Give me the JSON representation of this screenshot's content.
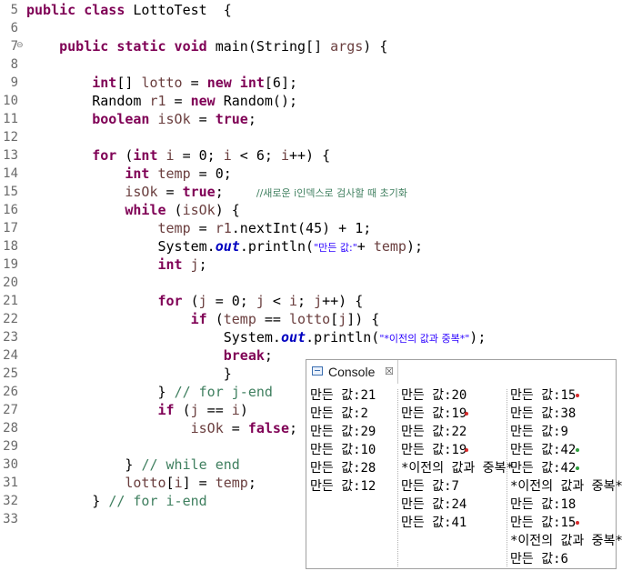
{
  "editor": {
    "lines": [
      {
        "n": "5",
        "tokens": [
          {
            "t": "public class",
            "c": "kw"
          },
          {
            "t": " LottoTest  {"
          }
        ]
      },
      {
        "n": "6",
        "tokens": []
      },
      {
        "n": "7",
        "fold": "⊖",
        "tokens": [
          {
            "t": "    "
          },
          {
            "t": "public static void",
            "c": "kw"
          },
          {
            "t": " main(String[] "
          },
          {
            "t": "args",
            "c": "var"
          },
          {
            "t": ") {"
          }
        ]
      },
      {
        "n": "8",
        "tokens": []
      },
      {
        "n": "9",
        "tokens": [
          {
            "t": "        "
          },
          {
            "t": "int",
            "c": "kw"
          },
          {
            "t": "[] "
          },
          {
            "t": "lotto",
            "c": "var"
          },
          {
            "t": " = "
          },
          {
            "t": "new int",
            "c": "kw"
          },
          {
            "t": "[6];"
          }
        ]
      },
      {
        "n": "10",
        "tokens": [
          {
            "t": "        Random "
          },
          {
            "t": "r1",
            "c": "var"
          },
          {
            "t": " = "
          },
          {
            "t": "new",
            "c": "kw"
          },
          {
            "t": " Random();"
          }
        ]
      },
      {
        "n": "11",
        "tokens": [
          {
            "t": "        "
          },
          {
            "t": "boolean",
            "c": "kw"
          },
          {
            "t": " "
          },
          {
            "t": "isOk",
            "c": "var"
          },
          {
            "t": " = "
          },
          {
            "t": "true",
            "c": "kw"
          },
          {
            "t": ";"
          }
        ]
      },
      {
        "n": "12",
        "tokens": []
      },
      {
        "n": "13",
        "tokens": [
          {
            "t": "        "
          },
          {
            "t": "for",
            "c": "kw"
          },
          {
            "t": " ("
          },
          {
            "t": "int",
            "c": "kw"
          },
          {
            "t": " "
          },
          {
            "t": "i",
            "c": "var"
          },
          {
            "t": " = 0; "
          },
          {
            "t": "i",
            "c": "var"
          },
          {
            "t": " < 6; "
          },
          {
            "t": "i",
            "c": "var"
          },
          {
            "t": "++) {"
          }
        ]
      },
      {
        "n": "14",
        "tokens": [
          {
            "t": "            "
          },
          {
            "t": "int",
            "c": "kw"
          },
          {
            "t": " "
          },
          {
            "t": "temp",
            "c": "var"
          },
          {
            "t": " = 0;"
          }
        ]
      },
      {
        "n": "15",
        "tokens": [
          {
            "t": "            "
          },
          {
            "t": "isOk",
            "c": "var"
          },
          {
            "t": " = "
          },
          {
            "t": "true",
            "c": "kw"
          },
          {
            "t": ";    "
          },
          {
            "t": "//새로운 i인덱스로 검사할 때 초기화",
            "c": "cm kor"
          }
        ]
      },
      {
        "n": "16",
        "tokens": [
          {
            "t": "            "
          },
          {
            "t": "while",
            "c": "kw"
          },
          {
            "t": " ("
          },
          {
            "t": "isOk",
            "c": "var"
          },
          {
            "t": ") {"
          }
        ]
      },
      {
        "n": "17",
        "tokens": [
          {
            "t": "                "
          },
          {
            "t": "temp",
            "c": "var"
          },
          {
            "t": " = "
          },
          {
            "t": "r1",
            "c": "var"
          },
          {
            "t": ".nextInt(45) + 1;"
          }
        ]
      },
      {
        "n": "18",
        "tokens": [
          {
            "t": "                System."
          },
          {
            "t": "out",
            "c": "fld"
          },
          {
            "t": ".println("
          },
          {
            "t": "\"만든 값:\"",
            "c": "str kor"
          },
          {
            "t": "+ "
          },
          {
            "t": "temp",
            "c": "var"
          },
          {
            "t": ");"
          }
        ]
      },
      {
        "n": "19",
        "tokens": [
          {
            "t": "                "
          },
          {
            "t": "int",
            "c": "kw"
          },
          {
            "t": " "
          },
          {
            "t": "j",
            "c": "var"
          },
          {
            "t": ";"
          }
        ]
      },
      {
        "n": "20",
        "tokens": []
      },
      {
        "n": "21",
        "tokens": [
          {
            "t": "                "
          },
          {
            "t": "for",
            "c": "kw"
          },
          {
            "t": " ("
          },
          {
            "t": "j",
            "c": "var"
          },
          {
            "t": " = 0; "
          },
          {
            "t": "j",
            "c": "var"
          },
          {
            "t": " < "
          },
          {
            "t": "i",
            "c": "var"
          },
          {
            "t": "; "
          },
          {
            "t": "j",
            "c": "var"
          },
          {
            "t": "++) {"
          }
        ]
      },
      {
        "n": "22",
        "tokens": [
          {
            "t": "                    "
          },
          {
            "t": "if",
            "c": "kw"
          },
          {
            "t": " ("
          },
          {
            "t": "temp",
            "c": "var"
          },
          {
            "t": " == "
          },
          {
            "t": "lotto",
            "c": "var"
          },
          {
            "t": "["
          },
          {
            "t": "j",
            "c": "var"
          },
          {
            "t": "]) {"
          }
        ]
      },
      {
        "n": "23",
        "tokens": [
          {
            "t": "                        System."
          },
          {
            "t": "out",
            "c": "fld"
          },
          {
            "t": ".println("
          },
          {
            "t": "\"*이전의 값과 중복*\"",
            "c": "str kor"
          },
          {
            "t": ");"
          }
        ]
      },
      {
        "n": "24",
        "tokens": [
          {
            "t": "                        "
          },
          {
            "t": "break",
            "c": "kw"
          },
          {
            "t": ";"
          }
        ]
      },
      {
        "n": "25",
        "tokens": [
          {
            "t": "                        }"
          }
        ]
      },
      {
        "n": "26",
        "tokens": [
          {
            "t": "                } "
          },
          {
            "t": "// for j-end",
            "c": "cm"
          }
        ]
      },
      {
        "n": "27",
        "tokens": [
          {
            "t": "                "
          },
          {
            "t": "if",
            "c": "kw"
          },
          {
            "t": " ("
          },
          {
            "t": "j",
            "c": "var"
          },
          {
            "t": " == "
          },
          {
            "t": "i",
            "c": "var"
          },
          {
            "t": ")"
          }
        ]
      },
      {
        "n": "28",
        "tokens": [
          {
            "t": "                    "
          },
          {
            "t": "isOk",
            "c": "var"
          },
          {
            "t": " = "
          },
          {
            "t": "false",
            "c": "kw"
          },
          {
            "t": ";"
          }
        ]
      },
      {
        "n": "29",
        "tokens": []
      },
      {
        "n": "30",
        "tokens": [
          {
            "t": "            } "
          },
          {
            "t": "// while end",
            "c": "cm"
          }
        ]
      },
      {
        "n": "31",
        "tokens": [
          {
            "t": "            "
          },
          {
            "t": "lotto",
            "c": "var"
          },
          {
            "t": "["
          },
          {
            "t": "i",
            "c": "var"
          },
          {
            "t": "] = "
          },
          {
            "t": "temp",
            "c": "var"
          },
          {
            "t": ";"
          }
        ]
      },
      {
        "n": "32",
        "tokens": [
          {
            "t": "        } "
          },
          {
            "t": "// for i-end",
            "c": "cm"
          }
        ]
      },
      {
        "n": "33",
        "tokens": []
      }
    ]
  },
  "console": {
    "title": "Console",
    "close_glyph": "☒",
    "columns": [
      [
        {
          "text": "만든 값:21"
        },
        {
          "text": "만든 값:2"
        },
        {
          "text": "만든 값:29"
        },
        {
          "text": "만든 값:10"
        },
        {
          "text": "만든 값:28"
        },
        {
          "text": "만든 값:12"
        }
      ],
      [
        {
          "text": "만든 값:20"
        },
        {
          "text": "만든 값:19",
          "dot": "#d62b2b"
        },
        {
          "text": "만든 값:22"
        },
        {
          "text": "만든 값:19",
          "dot": "#d62b2b"
        },
        {
          "text": "*이전의 값과 중복*"
        },
        {
          "text": "만든 값:7"
        },
        {
          "text": "만든 값:24"
        },
        {
          "text": "만든 값:41"
        }
      ],
      [
        {
          "text": "만든 값:15",
          "dot": "#d62b2b"
        },
        {
          "text": "만든 값:38"
        },
        {
          "text": "만든 값:9"
        },
        {
          "text": "만든 값:42",
          "dot": "#2e9e3e"
        },
        {
          "text": "만든 값:42",
          "dot": "#2e9e3e"
        },
        {
          "text": "*이전의 값과 중복*"
        },
        {
          "text": "만든 값:18"
        },
        {
          "text": "만든 값:15",
          "dot": "#d62b2b"
        },
        {
          "text": "*이전의 값과 중복*"
        },
        {
          "text": "만든 값:6"
        }
      ]
    ]
  }
}
